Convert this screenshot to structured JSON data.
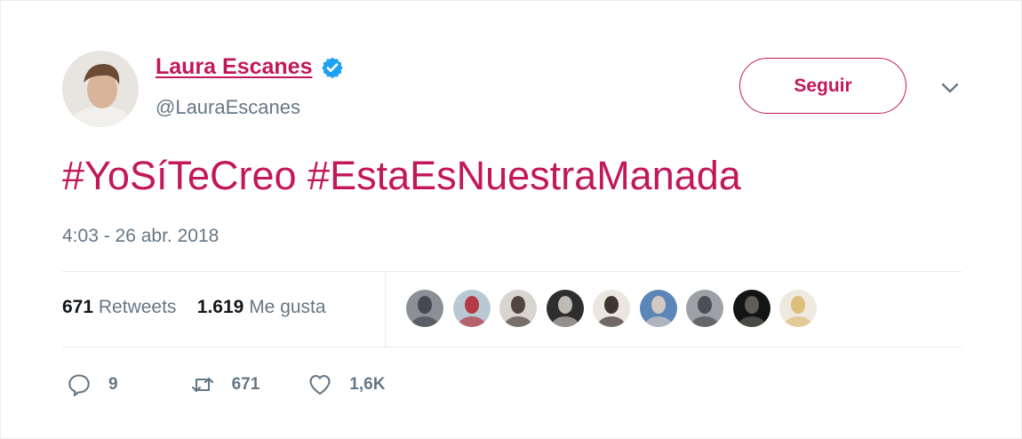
{
  "user": {
    "name": "Laura Escanes",
    "handle": "@LauraEscanes",
    "follow_label": "Seguir"
  },
  "tweet": {
    "hashtags": [
      "#YoSíTeCreo",
      "#EstaEsNuestraManada"
    ],
    "timestamp": "4:03 - 26 abr. 2018"
  },
  "stats": {
    "retweets_count": "671",
    "retweets_label": "Retweets",
    "likes_count": "1.619",
    "likes_label": "Me gusta"
  },
  "likers": [
    {
      "name": "liker-1",
      "bg": "#8c8f96",
      "fg": "#3a3d44"
    },
    {
      "name": "liker-2",
      "bg": "#b9c9d4",
      "fg": "#b3212c"
    },
    {
      "name": "liker-3",
      "bg": "#d8d4cf",
      "fg": "#3b2c26"
    },
    {
      "name": "liker-4",
      "bg": "#2e2e2e",
      "fg": "#d9d2cb"
    },
    {
      "name": "liker-5",
      "bg": "#ece6e1",
      "fg": "#1f1612"
    },
    {
      "name": "liker-6",
      "bg": "#5d86b8",
      "fg": "#e7d4c3"
    },
    {
      "name": "liker-7",
      "bg": "#9da1a5",
      "fg": "#3e4045"
    },
    {
      "name": "liker-8",
      "bg": "#121514",
      "fg": "#6f6a64"
    },
    {
      "name": "liker-9",
      "bg": "#efe9df",
      "fg": "#d9b76a"
    }
  ],
  "actions": {
    "replies": "9",
    "retweets": "671",
    "likes": "1,6K"
  },
  "icons": {
    "verified": "verified-badge-icon",
    "more": "chevron-down-icon",
    "reply": "reply-icon",
    "retweet": "retweet-icon",
    "like": "heart-icon"
  },
  "colors": {
    "accent": "#c2185b",
    "muted": "#657786",
    "verified": "#1da1f2"
  }
}
